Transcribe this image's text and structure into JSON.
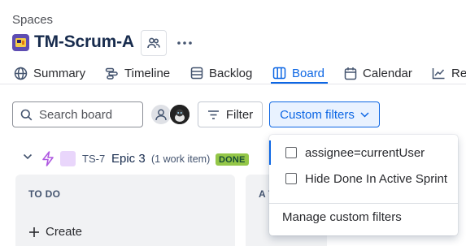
{
  "header": {
    "breadcrumb": "Spaces",
    "project_name": "TM-Scrum-A",
    "project_icon": "project-avatar-icon",
    "more_label": "…"
  },
  "tabs": [
    {
      "label": "Summary",
      "icon": "globe-icon"
    },
    {
      "label": "Timeline",
      "icon": "timeline-icon"
    },
    {
      "label": "Backlog",
      "icon": "backlog-icon"
    },
    {
      "label": "Board",
      "icon": "board-icon",
      "active": true
    },
    {
      "label": "Calendar",
      "icon": "calendar-icon"
    },
    {
      "label": "Re",
      "icon": "reports-icon"
    }
  ],
  "toolbar": {
    "search_placeholder": "Search board",
    "filter_label": "Filter",
    "custom_filters_label": "Custom filters"
  },
  "epic": {
    "key": "TS-7",
    "name": "Epic 3",
    "count": "(1 work item)",
    "status": "DONE"
  },
  "columns": [
    {
      "title": "TO DO",
      "create_label": "Create"
    },
    {
      "title": "A T"
    }
  ],
  "dropdown": {
    "options": [
      {
        "label": "assignee=currentUser",
        "checked": false
      },
      {
        "label": "Hide Done In Active Sprint",
        "checked": false
      }
    ],
    "manage_label": "Manage custom filters"
  },
  "colors": {
    "accent": "#0c66e4",
    "done_badge": "#94c748",
    "project_icon": "#5e4db2",
    "epic_swatch": "#e9d6fb",
    "epic_icon": "#af59e1"
  }
}
